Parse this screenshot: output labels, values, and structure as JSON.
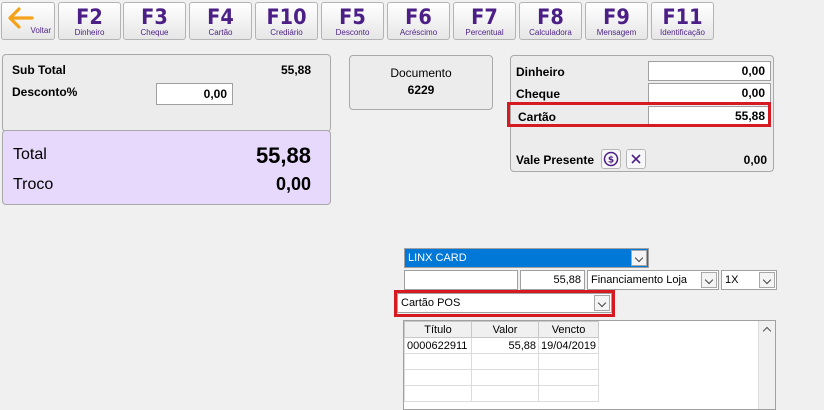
{
  "toolbar": {
    "back_label": "Voltar",
    "buttons": [
      {
        "key": "F2",
        "label": "Dinheiro"
      },
      {
        "key": "F3",
        "label": "Cheque"
      },
      {
        "key": "F4",
        "label": "Cartão"
      },
      {
        "key": "F10",
        "label": "Crediário"
      },
      {
        "key": "F5",
        "label": "Desconto"
      },
      {
        "key": "F6",
        "label": "Acréscimo"
      },
      {
        "key": "F7",
        "label": "Percentual"
      },
      {
        "key": "F8",
        "label": "Calculadora"
      },
      {
        "key": "F9",
        "label": "Mensagem"
      },
      {
        "key": "F11",
        "label": "Identificação"
      }
    ]
  },
  "summary": {
    "subtotal_label": "Sub Total",
    "subtotal_value": "55,88",
    "discount_label": "Desconto%",
    "discount_value": "0,00",
    "total_label": "Total",
    "total_value": "55,88",
    "change_label": "Troco",
    "change_value": "0,00"
  },
  "document": {
    "label": "Documento",
    "number": "6229"
  },
  "payments": {
    "cash_label": "Dinheiro",
    "cash_value": "0,00",
    "check_label": "Cheque",
    "check_value": "0,00",
    "card_label": "Cartão",
    "card_value": "55,88",
    "gift_label": "Vale Presente",
    "gift_value": "0,00"
  },
  "card": {
    "operator_selected": "LINX CARD",
    "amount": "55,88",
    "plan_selected": "Financiamento Loja",
    "installments_selected": "1X",
    "terminal_selected": "Cartão POS"
  },
  "grid": {
    "headers": [
      "Título",
      "Valor",
      "Vencto"
    ],
    "rows": [
      [
        "0000622911",
        "55,88",
        "19/04/2019"
      ]
    ]
  },
  "colors": {
    "accent_purple": "#4b1f86",
    "total_panel_bg": "#e6d9fb",
    "highlight_red": "#d51a22",
    "selection_blue": "#0078d7",
    "back_arrow_orange": "#f5a21b"
  }
}
